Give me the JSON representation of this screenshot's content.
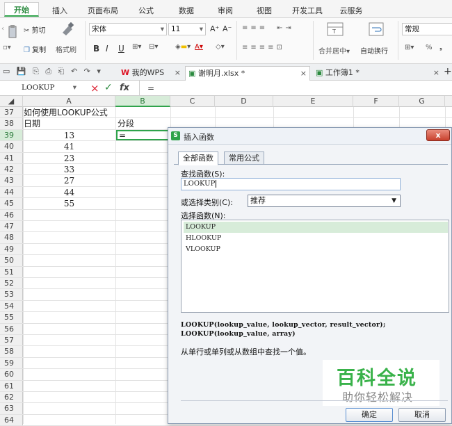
{
  "ribbon_tabs": [
    "开始",
    "插入",
    "页面布局",
    "公式",
    "数据",
    "审阅",
    "视图",
    "开发工具",
    "云服务"
  ],
  "ribbon": {
    "cut": "剪切",
    "copy": "复制",
    "format_painter": "格式刷",
    "font_name": "宋体",
    "font_size": "11",
    "bold": "B",
    "italic": "I",
    "underline": "U",
    "grow": "A⁺",
    "shrink": "A⁻",
    "merge_center": "合并居中",
    "wrap": "自动换行",
    "number_format": "常规",
    "percent": "%"
  },
  "doc_tabs": {
    "wps_label": "我的WPS",
    "file_label": "谢明月.xlsx *",
    "book_label": "工作簿1 *",
    "close": "×",
    "add": "+"
  },
  "formula_bar": {
    "name_box": "LOOKUP",
    "cancel": "×",
    "confirm": "✓",
    "fx": "fx",
    "content": "="
  },
  "columns": [
    "A",
    "B",
    "C",
    "D",
    "E",
    "F",
    "G"
  ],
  "rows": [
    {
      "num": "37",
      "a": "如何使用LOOKUP公式",
      "b": ""
    },
    {
      "num": "38",
      "a": "日期",
      "b": "分段"
    },
    {
      "num": "39",
      "a": "13",
      "b": "="
    },
    {
      "num": "40",
      "a": "41",
      "b": ""
    },
    {
      "num": "41",
      "a": "23",
      "b": ""
    },
    {
      "num": "42",
      "a": "33",
      "b": ""
    },
    {
      "num": "43",
      "a": "27",
      "b": ""
    },
    {
      "num": "44",
      "a": "44",
      "b": ""
    },
    {
      "num": "45",
      "a": "55",
      "b": ""
    },
    {
      "num": "46",
      "a": "",
      "b": ""
    },
    {
      "num": "47",
      "a": "",
      "b": ""
    },
    {
      "num": "48",
      "a": "",
      "b": ""
    },
    {
      "num": "49",
      "a": "",
      "b": ""
    },
    {
      "num": "50",
      "a": "",
      "b": ""
    },
    {
      "num": "51",
      "a": "",
      "b": ""
    },
    {
      "num": "52",
      "a": "",
      "b": ""
    },
    {
      "num": "53",
      "a": "",
      "b": ""
    },
    {
      "num": "54",
      "a": "",
      "b": ""
    },
    {
      "num": "55",
      "a": "",
      "b": ""
    },
    {
      "num": "56",
      "a": "",
      "b": ""
    },
    {
      "num": "57",
      "a": "",
      "b": ""
    },
    {
      "num": "58",
      "a": "",
      "b": ""
    },
    {
      "num": "59",
      "a": "",
      "b": ""
    },
    {
      "num": "60",
      "a": "",
      "b": ""
    },
    {
      "num": "61",
      "a": "",
      "b": ""
    },
    {
      "num": "62",
      "a": "",
      "b": ""
    },
    {
      "num": "63",
      "a": "",
      "b": ""
    },
    {
      "num": "64",
      "a": "",
      "b": ""
    }
  ],
  "dialog": {
    "title": "插入函数",
    "close": "x",
    "tab_all": "全部函数",
    "tab_common": "常用公式",
    "search_label": "查找函数(S):",
    "search_value": "LOOKUP",
    "category_label": "或选择类别(C):",
    "category_value": "推荐",
    "select_label": "选择函数(N):",
    "functions": [
      "LOOKUP",
      "HLOOKUP",
      "VLOOKUP"
    ],
    "syntax_1": "LOOKUP(lookup_value, lookup_vector, result_vector);",
    "syntax_2": "LOOKUP(lookup_value, array)",
    "description": "从单行或单列或从数组中查找一个值。",
    "ok": "确定",
    "cancel": "取消"
  },
  "watermark": {
    "title": "百科全说",
    "subtitle": "助你轻松解决"
  },
  "colors": {
    "accent": "#2fa34b",
    "selection": "#d7ecd9",
    "dialog_border": "#8a9bb3"
  }
}
